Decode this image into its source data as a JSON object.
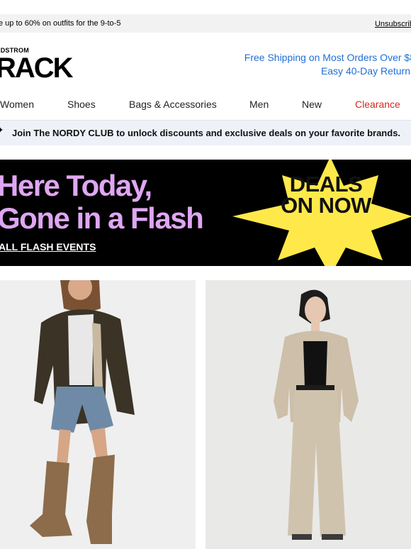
{
  "preheader": {
    "promo": "e up to 60% on outfits for the 9-to-5",
    "unsubscribe": "Unsubscrib"
  },
  "logo": {
    "small": "RDSTROM",
    "big": "RACK"
  },
  "shipping": {
    "line1": "Free Shipping on Most Orders Over $8",
    "line2": "Easy 40-Day Returns"
  },
  "nav": {
    "items": [
      "Women",
      "Shoes",
      "Bags & Accessories",
      "Men",
      "New",
      "Clearance"
    ],
    "clearance_color": "#d7291e"
  },
  "club": {
    "icon": "sparkle-icon",
    "text": "Join The NORDY CLUB to unlock discounts and exclusive deals on your favorite brands."
  },
  "banner": {
    "headline1": "Here Today,",
    "headline2": "Gone in a Flash",
    "cta": "ALL FLASH EVENTS",
    "burst1": "DEALS",
    "burst2": "ON NOW",
    "headline_color": "#dfa6f2",
    "burst_color": "#ffe94a"
  },
  "products": [
    {
      "image": "woman-in-olive-jacket-denim-shorts-boots"
    },
    {
      "image": "woman-in-khaki-shirt-jacket-and-wide-pants"
    }
  ]
}
